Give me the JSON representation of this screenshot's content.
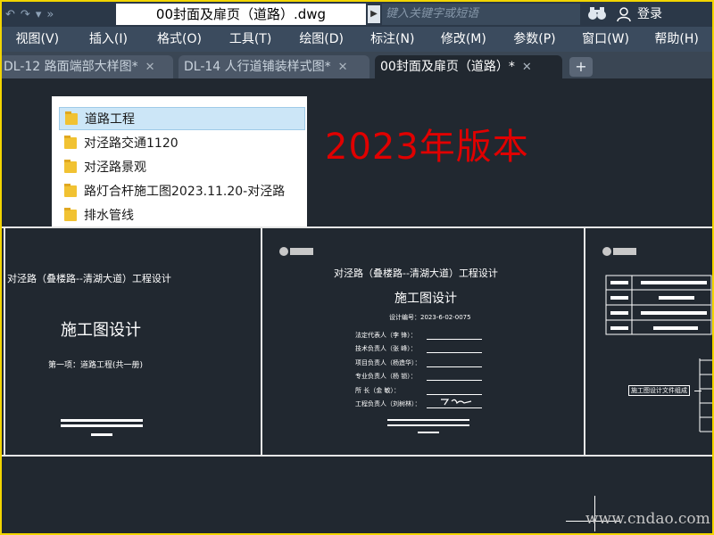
{
  "titlebar": {
    "document_title": "00封面及扉页（道路）.dwg",
    "search_placeholder": "键入关键字或短语",
    "login_label": "登录"
  },
  "menu": [
    "视图(V)",
    "插入(I)",
    "格式(O)",
    "工具(T)",
    "绘图(D)",
    "标注(N)",
    "修改(M)",
    "参数(P)",
    "窗口(W)",
    "帮助(H)"
  ],
  "tabs": [
    {
      "label": "DL-12 路面端部大样图*",
      "close": "✕",
      "active": false
    },
    {
      "label": "DL-14 人行道铺装样式图*",
      "close": "✕",
      "active": false
    },
    {
      "label": "00封面及扉页（道路）*",
      "close": "✕",
      "active": true
    }
  ],
  "plus_tab": "+",
  "file_list": [
    {
      "name": "道路工程",
      "selected": true
    },
    {
      "name": "对泾路交通1120",
      "selected": false
    },
    {
      "name": "对泾路景观",
      "selected": false
    },
    {
      "name": "路灯合杆施工图2023.11.20-对泾路",
      "selected": false
    },
    {
      "name": "排水管线",
      "selected": false
    }
  ],
  "overlay_text": "2023年版本",
  "sheet1": {
    "project": "对泾路（叠楼路--清湖大道）工程设计",
    "title": "施工图设计",
    "subtitle": "第一项：道路工程(共一册)"
  },
  "sheet2": {
    "project": "对泾路（叠楼路--清湖大道）工程设计",
    "title": "施工图设计",
    "design_no": "设计编号：2023-6-02-0075",
    "rows": [
      "法定代表人（李  锋）：",
      "技术负责人（张  峰）：",
      "项目负责人（杨造华）：",
      "专业负责人（杨  锁）：",
      "所       长（金  敏）：",
      "工程负责人（刘树林）："
    ]
  },
  "sheet3": {
    "label": "施工图设计文件组成"
  },
  "watermark": "www.cndao.com"
}
